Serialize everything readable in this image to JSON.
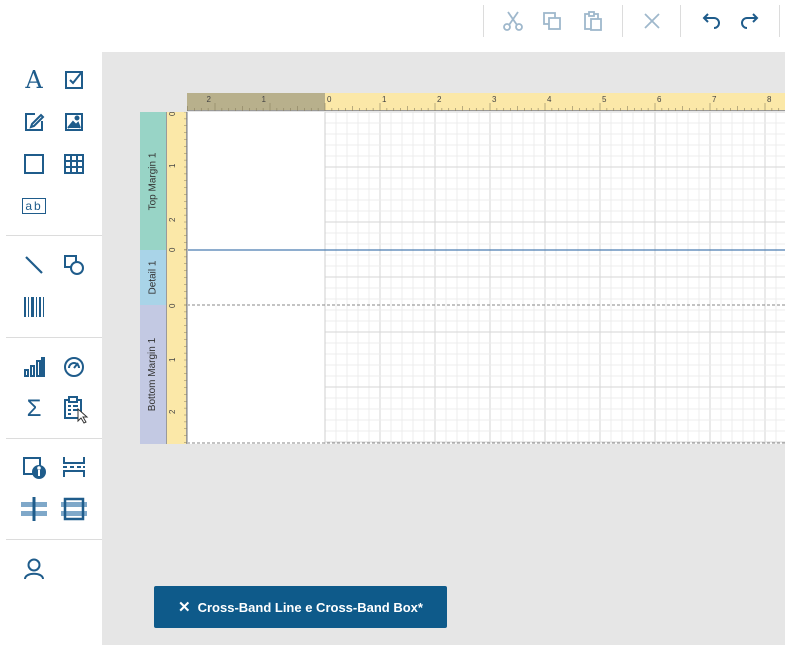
{
  "toolbar": {
    "items": [
      {
        "name": "cut-icon",
        "enabled": false
      },
      {
        "name": "copy-icon",
        "enabled": false
      },
      {
        "name": "paste-icon",
        "enabled": false
      },
      {
        "name": "delete-icon",
        "enabled": false
      },
      {
        "name": "undo-icon",
        "enabled": true
      },
      {
        "name": "redo-icon",
        "enabled": true
      }
    ]
  },
  "sidebar": {
    "tools": [
      {
        "icon": "label-icon",
        "glyph": "A"
      },
      {
        "icon": "checkbox-icon"
      },
      {
        "icon": "rich-text-icon"
      },
      {
        "icon": "picture-box-icon"
      },
      {
        "icon": "panel-icon"
      },
      {
        "icon": "table-icon"
      },
      {
        "icon": "character-comb-icon",
        "glyph": "ab"
      },
      {
        "icon": "line-icon"
      },
      {
        "icon": "shape-icon"
      },
      {
        "icon": "barcode-icon"
      },
      {
        "icon": "chart-icon"
      },
      {
        "icon": "gauge-icon"
      },
      {
        "icon": "sparkline-icon",
        "glyph": "Σ"
      },
      {
        "icon": "pivot-grid-icon"
      },
      {
        "icon": "page-info-icon"
      },
      {
        "icon": "page-break-icon"
      },
      {
        "icon": "cross-band-line-icon"
      },
      {
        "icon": "cross-band-box-icon"
      },
      {
        "icon": "subreport-icon"
      }
    ]
  },
  "ruler": {
    "horizontal_labels": [
      "2",
      "1",
      "0",
      "1",
      "2",
      "3",
      "4",
      "5",
      "6",
      "7",
      "8"
    ],
    "vertical_labels": [
      "0",
      "1",
      "2",
      "0",
      "0",
      "1",
      "2"
    ]
  },
  "bands": {
    "top_margin": "Top Margin 1",
    "detail": "Detail 1",
    "bottom_margin": "Bottom Margin 1"
  },
  "colors": {
    "accent": "#0e5a8a",
    "icon": "#1f5c8b",
    "icon_disabled": "#9fb8cc",
    "ruler_bg": "#fbe8a8",
    "ruler_dark": "#b8b08c",
    "top_margin_band": "#98d4c6",
    "detail_band": "#a9d4e8",
    "bottom_margin_band": "#c3c9e3",
    "band_line": "#4a7cb0"
  },
  "status": {
    "label": "Cross-Band Line e Cross-Band Box*"
  }
}
